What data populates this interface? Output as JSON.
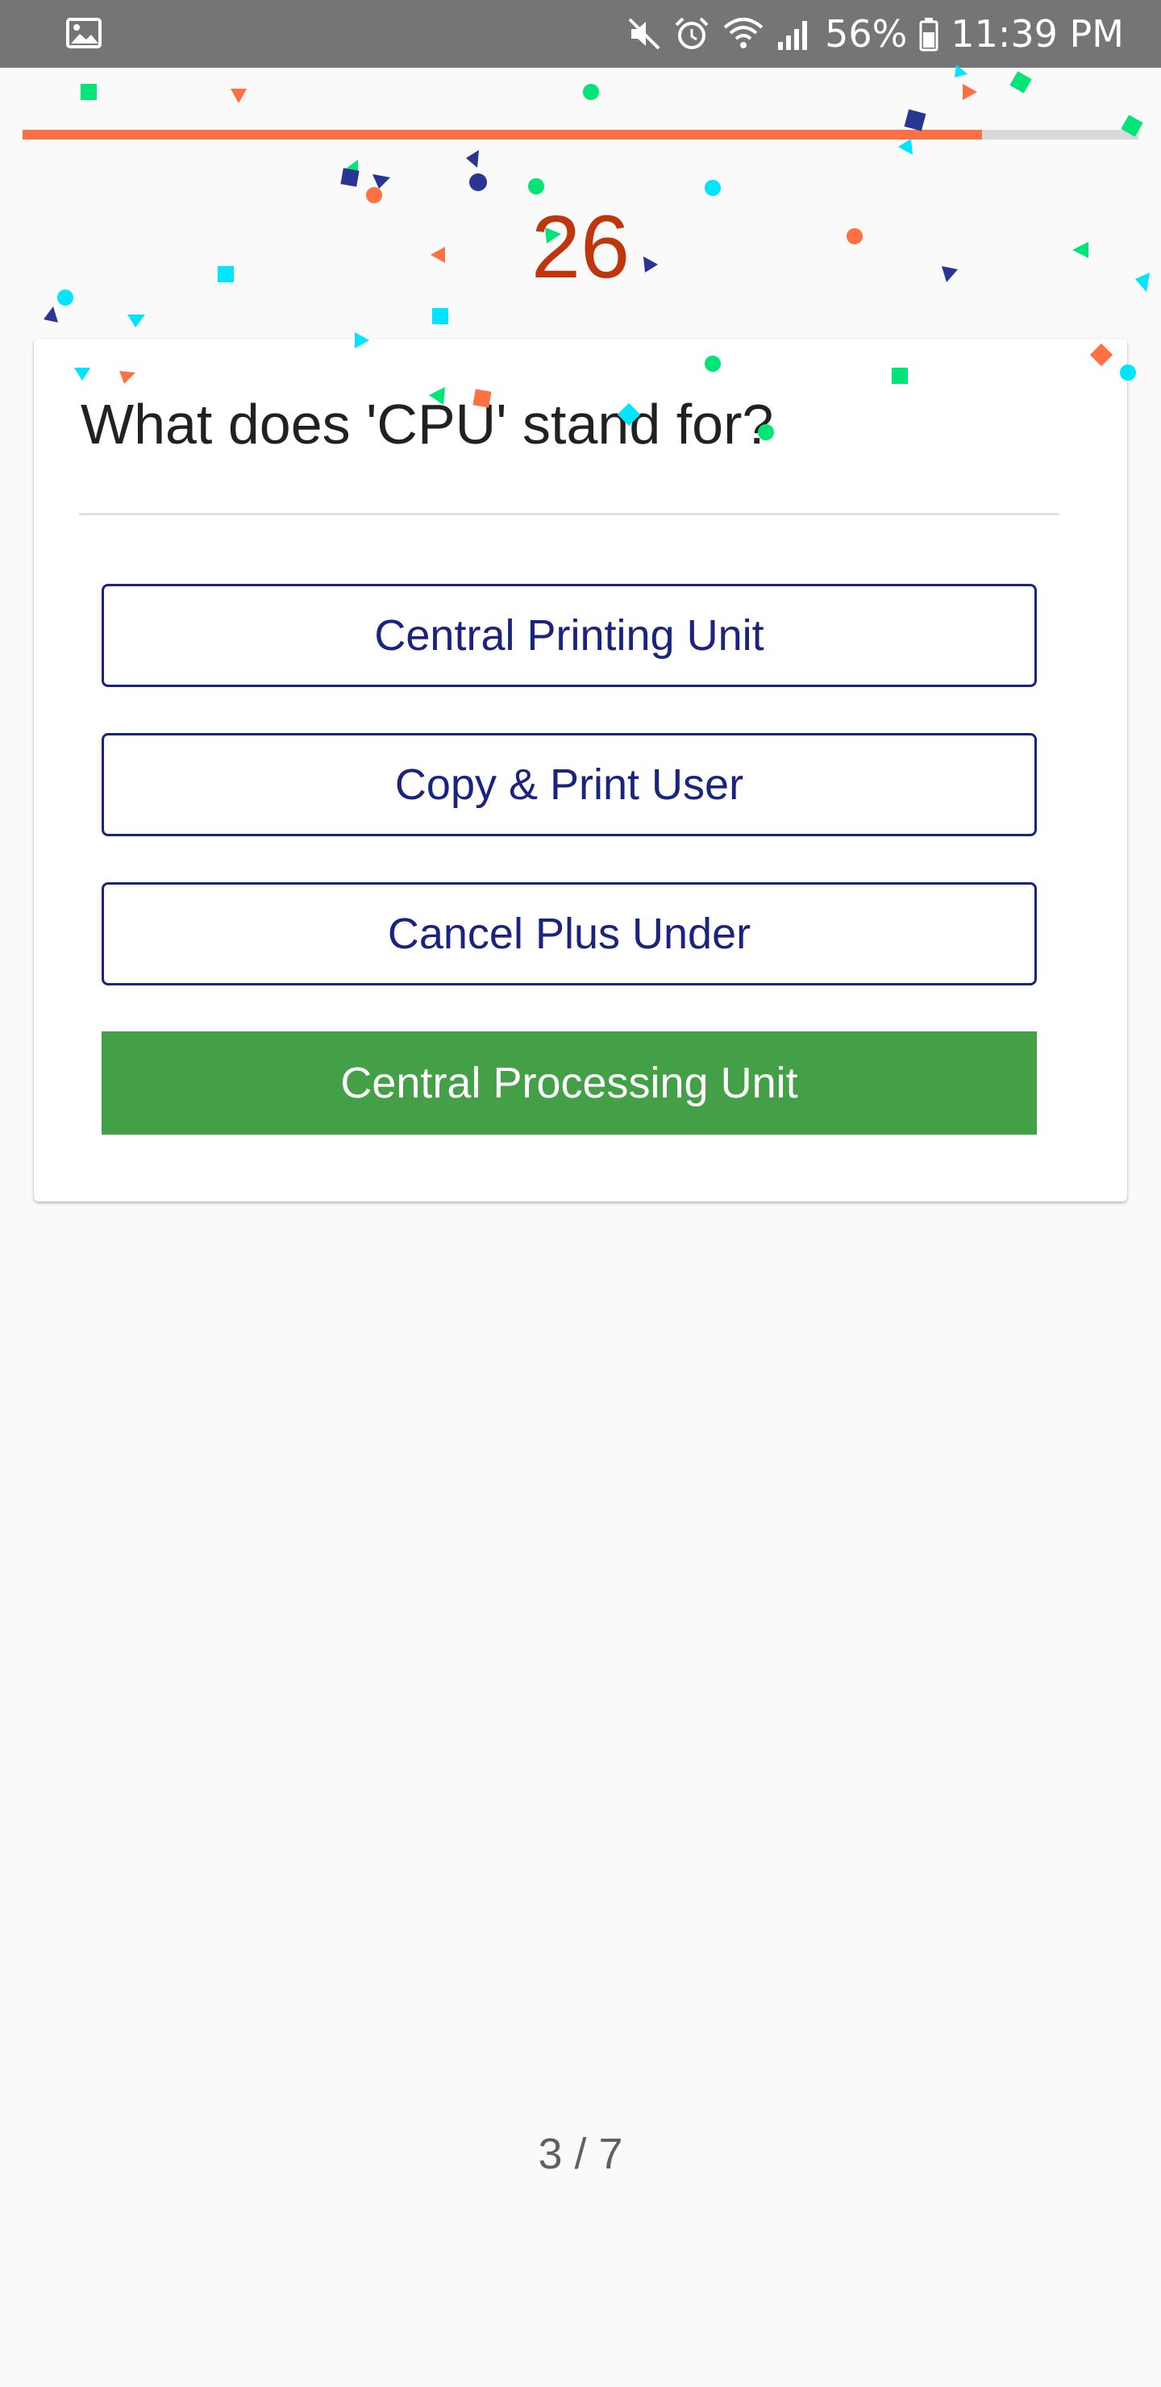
{
  "status_bar": {
    "time": "11:39 PM",
    "battery_percent": "56%",
    "icons": [
      "gallery-icon",
      "mute-icon",
      "alarm-icon",
      "wifi-icon",
      "signal-icon",
      "battery-icon"
    ],
    "background": "#757575"
  },
  "quiz": {
    "progress_fraction": 0.86,
    "progress_color": "#ff7043",
    "timer": "26",
    "timer_color": "#bf360c",
    "question": "What does 'CPU' stand for?",
    "answers": [
      {
        "label": "Central Printing Unit",
        "state": "default"
      },
      {
        "label": "Copy & Print User",
        "state": "default"
      },
      {
        "label": "Cancel Plus Under",
        "state": "default"
      },
      {
        "label": "Central Processing Unit",
        "state": "correct"
      }
    ],
    "correct_color": "#43a047",
    "outline_color": "#1a237e",
    "page_indicator": "3 / 7"
  },
  "confetti_colors": [
    "#00e676",
    "#ff7043",
    "#00e5ff",
    "#283593"
  ]
}
